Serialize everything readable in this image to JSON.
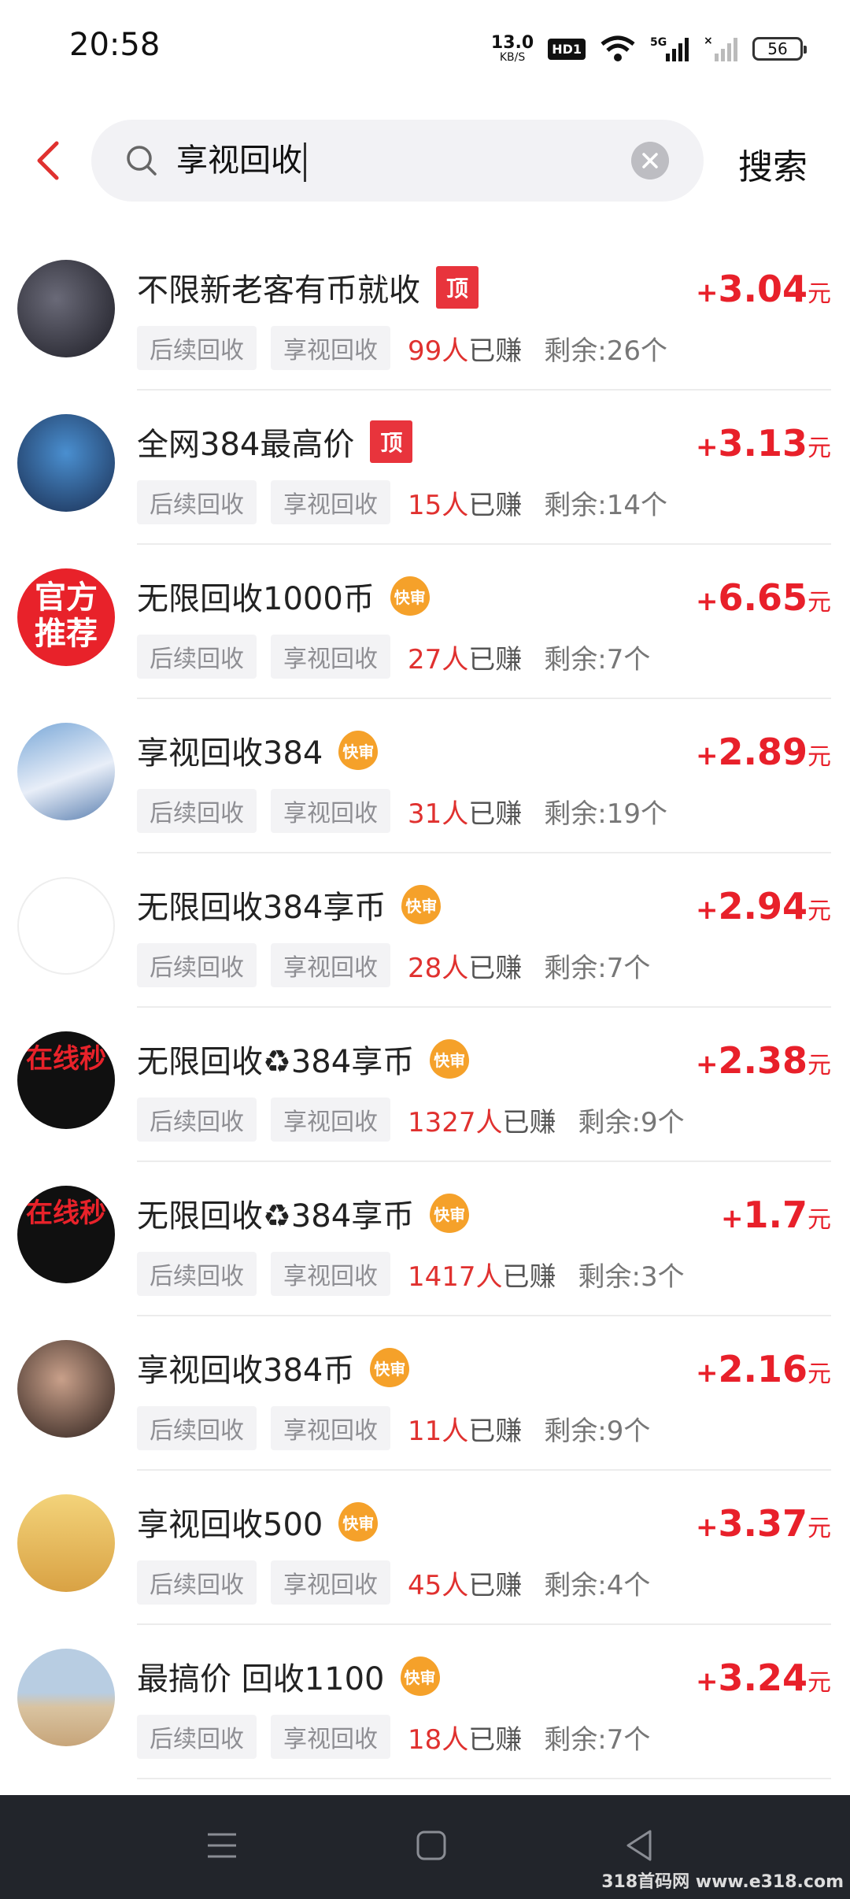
{
  "status_bar": {
    "time": "20:58",
    "net_speed_value": "13.0",
    "net_speed_unit": "KB/S",
    "hd_label": "HD1",
    "network_label": "5G",
    "battery": "56"
  },
  "search": {
    "query": "享视回收",
    "button_label": "搜索"
  },
  "tasks": [
    {
      "title": "不限新老客有币就收",
      "badge": "顶",
      "tags": [
        "后续回收",
        "享视回收"
      ],
      "earned_count": "99人",
      "earned_suffix": "已赚",
      "remaining": "剩余:26个",
      "price_sign": "+",
      "price": "3.04",
      "unit": "元",
      "avatar_text": ""
    },
    {
      "title": "全网384最高价",
      "badge": "顶",
      "tags": [
        "后续回收",
        "享视回收"
      ],
      "earned_count": "15人",
      "earned_suffix": "已赚",
      "remaining": "剩余:14个",
      "price_sign": "+",
      "price": "3.13",
      "unit": "元",
      "avatar_text": ""
    },
    {
      "title": "无限回收1000币",
      "badge": "快审",
      "tags": [
        "后续回收",
        "享视回收"
      ],
      "earned_count": "27人",
      "earned_suffix": "已赚",
      "remaining": "剩余:7个",
      "price_sign": "+",
      "price": "6.65",
      "unit": "元",
      "avatar_text": "官方推荐"
    },
    {
      "title": "享视回收384",
      "badge": "快审",
      "tags": [
        "后续回收",
        "享视回收"
      ],
      "earned_count": "31人",
      "earned_suffix": "已赚",
      "remaining": "剩余:19个",
      "price_sign": "+",
      "price": "2.89",
      "unit": "元",
      "avatar_text": ""
    },
    {
      "title": "无限回收384享币",
      "badge": "快审",
      "tags": [
        "后续回收",
        "享视回收"
      ],
      "earned_count": "28人",
      "earned_suffix": "已赚",
      "remaining": "剩余:7个",
      "price_sign": "+",
      "price": "2.94",
      "unit": "元",
      "avatar_text": ""
    },
    {
      "title": "无限回收♻384享币",
      "badge": "快审",
      "tags": [
        "后续回收",
        "享视回收"
      ],
      "earned_count": "1327人",
      "earned_suffix": "已赚",
      "remaining": "剩余:9个",
      "price_sign": "+",
      "price": "2.38",
      "unit": "元",
      "avatar_text": "在线秒"
    },
    {
      "title": "无限回收♻384享币",
      "badge": "快审",
      "tags": [
        "后续回收",
        "享视回收"
      ],
      "earned_count": "1417人",
      "earned_suffix": "已赚",
      "remaining": "剩余:3个",
      "price_sign": "+",
      "price": "1.7",
      "unit": "元",
      "avatar_text": "在线秒"
    },
    {
      "title": "享视回收384币",
      "badge": "快审",
      "tags": [
        "后续回收",
        "享视回收"
      ],
      "earned_count": "11人",
      "earned_suffix": "已赚",
      "remaining": "剩余:9个",
      "price_sign": "+",
      "price": "2.16",
      "unit": "元",
      "avatar_text": ""
    },
    {
      "title": "享视回收500",
      "badge": "快审",
      "tags": [
        "后续回收",
        "享视回收"
      ],
      "earned_count": "45人",
      "earned_suffix": "已赚",
      "remaining": "剩余:4个",
      "price_sign": "+",
      "price": "3.37",
      "unit": "元",
      "avatar_text": ""
    },
    {
      "title": "最搞价 回收1100",
      "badge": "快审",
      "tags": [
        "后续回收",
        "享视回收"
      ],
      "earned_count": "18人",
      "earned_suffix": "已赚",
      "remaining": "剩余:7个",
      "price_sign": "+",
      "price": "3.24",
      "unit": "元",
      "avatar_text": ""
    }
  ],
  "watermark": "318首码网 www.e318.com",
  "colors": {
    "accent_red": "#e8202a",
    "badge_top": "#e8343c",
    "badge_fast": "#f5a12a",
    "nav_bar": "#22252b"
  }
}
